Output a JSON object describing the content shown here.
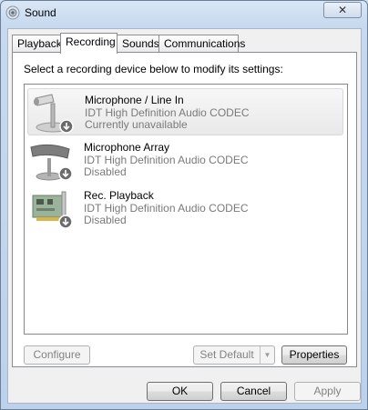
{
  "window": {
    "title": "Sound",
    "close_label": "✕"
  },
  "tabs": [
    {
      "label": "Playback",
      "active": false
    },
    {
      "label": "Recording",
      "active": true
    },
    {
      "label": "Sounds",
      "active": false
    },
    {
      "label": "Communications",
      "active": false
    }
  ],
  "recording": {
    "instruction": "Select a recording device below to modify its settings:",
    "devices": [
      {
        "name": "Microphone / Line In",
        "driver": "IDT High Definition Audio CODEC",
        "status": "Currently unavailable",
        "icon": "microphone-stand-icon",
        "selected": true
      },
      {
        "name": "Microphone Array",
        "driver": "IDT High Definition Audio CODEC",
        "status": "Disabled",
        "icon": "microphone-array-icon",
        "selected": false
      },
      {
        "name": "Rec. Playback",
        "driver": "IDT High Definition Audio CODEC",
        "status": "Disabled",
        "icon": "sound-card-icon",
        "selected": false
      }
    ],
    "buttons": {
      "configure": "Configure",
      "set_default": "Set Default",
      "properties": "Properties"
    }
  },
  "dialog_buttons": {
    "ok": "OK",
    "cancel": "Cancel",
    "apply": "Apply"
  },
  "colors": {
    "status_arrow_badge": "#6b6b6b",
    "selection_background": "#ececec"
  }
}
